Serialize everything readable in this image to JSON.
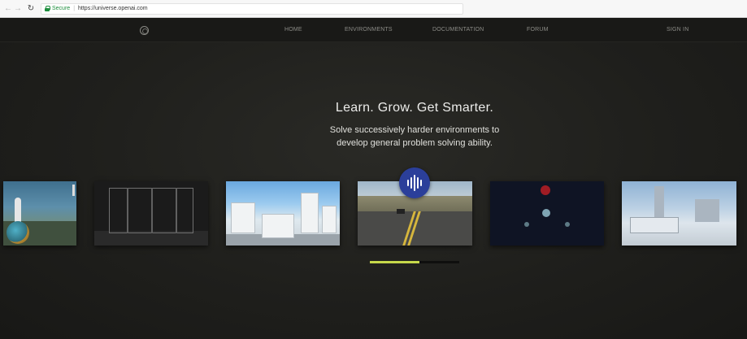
{
  "browser": {
    "secure_label": "Secure",
    "url": "https://universe.openai.com"
  },
  "nav": {
    "items": [
      "HOME",
      "ENVIRONMENTS",
      "DOCUMENTATION",
      "FORUM"
    ],
    "sign_in": "SIGN IN"
  },
  "hero": {
    "title": "Learn. Grow. Get Smarter.",
    "subtitle_line1": "Solve successively harder environments to",
    "subtitle_line2": "develop general problem solving ability."
  },
  "carousel": {
    "badge_icon": "audio-waveform-icon",
    "badge_color": "#2b3f9a",
    "progress": 0.55,
    "progress_color": "#c6d84a"
  }
}
